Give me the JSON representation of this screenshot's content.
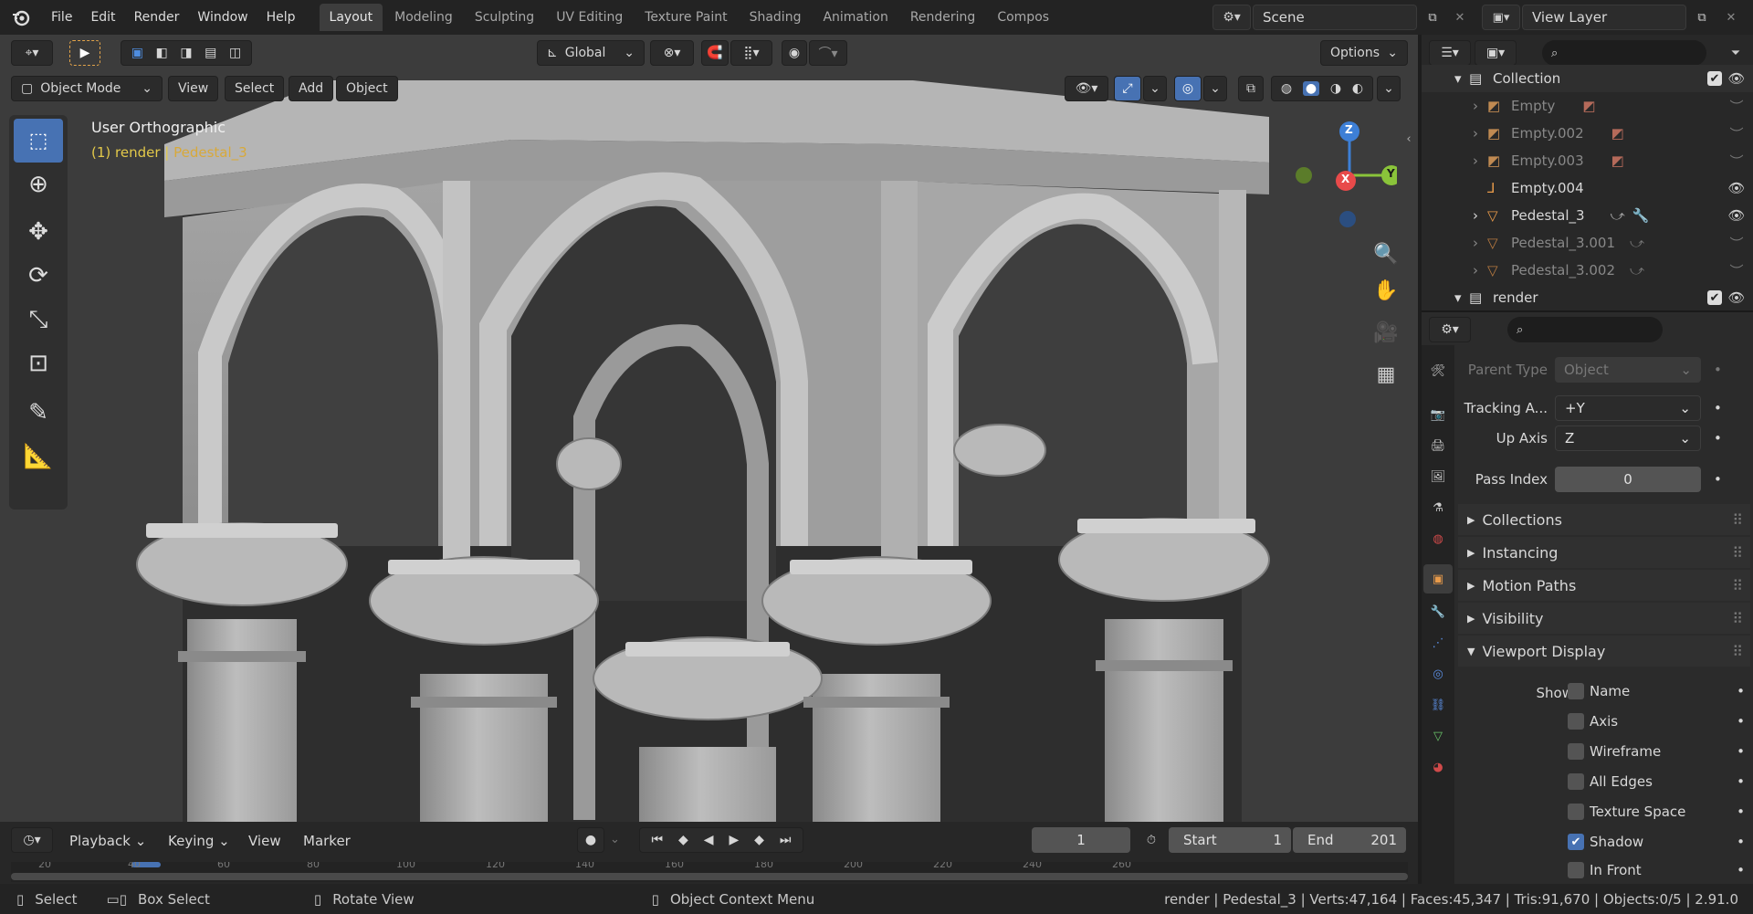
{
  "menus": [
    "File",
    "Edit",
    "Render",
    "Window",
    "Help"
  ],
  "workspaces": [
    "Layout",
    "Modeling",
    "Sculpting",
    "UV Editing",
    "Texture Paint",
    "Shading",
    "Animation",
    "Rendering",
    "Compos"
  ],
  "scene": "Scene",
  "view_layer": "View Layer",
  "viewport": {
    "orientation": "Global",
    "options": "Options",
    "mode": "Object Mode",
    "menus": [
      "View",
      "Select",
      "Add",
      "Object"
    ],
    "title": "User Orthographic",
    "info_prefix": "(1) render | ",
    "info_object": "Pedestal_3",
    "gizmo": {
      "x": "X",
      "y": "Y",
      "z": "Z"
    }
  },
  "outliner": {
    "search_placeholder": "",
    "items": [
      {
        "name": "Collection",
        "type": "collection"
      },
      {
        "name": "Empty",
        "type": "empty"
      },
      {
        "name": "Empty.002",
        "type": "empty"
      },
      {
        "name": "Empty.003",
        "type": "empty"
      },
      {
        "name": "Empty.004",
        "type": "empty"
      },
      {
        "name": "Pedestal_3",
        "type": "mesh"
      },
      {
        "name": "Pedestal_3.001",
        "type": "mesh"
      },
      {
        "name": "Pedestal_3.002",
        "type": "mesh"
      },
      {
        "name": "render",
        "type": "collection"
      }
    ]
  },
  "properties": {
    "parent_type_label": "Parent Type",
    "parent_type_value": "Object",
    "tracking_label": "Tracking A...",
    "tracking_value": "+Y",
    "up_axis_label": "Up Axis",
    "up_axis_value": "Z",
    "pass_index_label": "Pass Index",
    "pass_index_value": "0",
    "panels": [
      "Collections",
      "Instancing",
      "Motion Paths",
      "Visibility",
      "Viewport Display"
    ],
    "show_label": "Show",
    "checkboxes": [
      {
        "label": "Name",
        "checked": false
      },
      {
        "label": "Axis",
        "checked": false
      },
      {
        "label": "Wireframe",
        "checked": false
      },
      {
        "label": "All Edges",
        "checked": false
      },
      {
        "label": "Texture Space",
        "checked": false
      },
      {
        "label": "Shadow",
        "checked": true
      },
      {
        "label": "In Front",
        "checked": false
      }
    ]
  },
  "timeline": {
    "menus": [
      "Playback",
      "Keying",
      "View",
      "Marker"
    ],
    "current_frame": "1",
    "start_label": "Start",
    "start_value": "1",
    "end_label": "End",
    "end_value": "201",
    "ticks": [
      "20",
      "40",
      "60",
      "80",
      "100",
      "120",
      "140",
      "160",
      "180",
      "200",
      "220",
      "240",
      "260"
    ]
  },
  "status": {
    "select": "Select",
    "box_select": "Box Select",
    "rotate": "Rotate View",
    "context": "Object Context Menu",
    "stats": "render | Pedestal_3 | Verts:47,164 | Faces:45,347 | Tris:91,670 | Objects:0/5 | 2.91.0"
  },
  "colors": {
    "accent": "#4772b3",
    "x_axis": "#e84a4a",
    "y_axis": "#8ac43a",
    "z_axis": "#3d7fd6",
    "highlight": "#e3c94a"
  }
}
